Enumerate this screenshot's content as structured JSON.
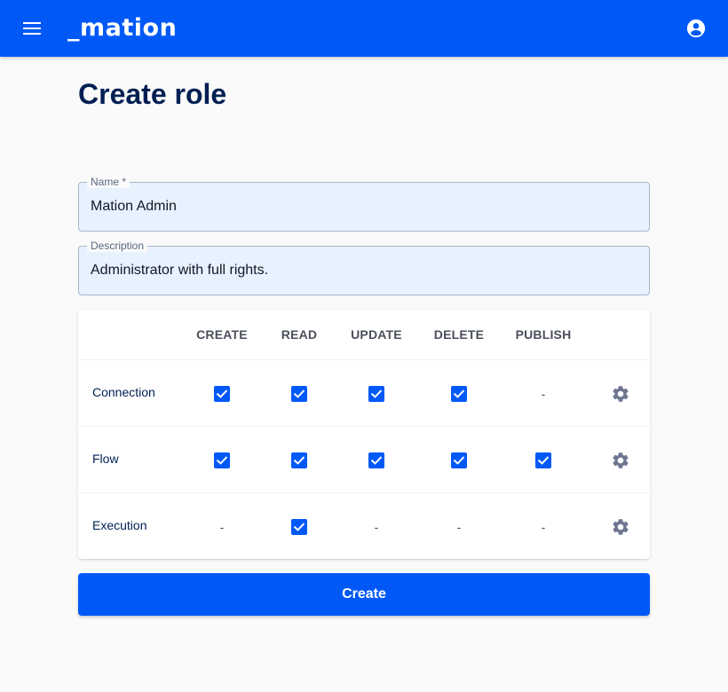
{
  "appbar": {
    "logo_text": "_mation",
    "menu_icon": "hamburger-menu-icon",
    "account_icon": "account-circle-icon",
    "background_color": "#0059f7"
  },
  "page": {
    "title": "Create role"
  },
  "form": {
    "name": {
      "label": "Name *",
      "value": "Mation Admin"
    },
    "description": {
      "label": "Description",
      "value": "Administrator with full rights."
    }
  },
  "permissions": {
    "columns": [
      "CREATE",
      "READ",
      "UPDATE",
      "DELETE",
      "PUBLISH"
    ],
    "dash_text": "-",
    "settings_icon": "gear-icon",
    "rows": [
      {
        "label": "Connection",
        "cells": [
          "checked",
          "checked",
          "checked",
          "checked",
          "none"
        ]
      },
      {
        "label": "Flow",
        "cells": [
          "checked",
          "checked",
          "checked",
          "checked",
          "checked"
        ]
      },
      {
        "label": "Execution",
        "cells": [
          "none",
          "checked",
          "none",
          "none",
          "none"
        ]
      }
    ]
  },
  "actions": {
    "create_label": "Create"
  }
}
